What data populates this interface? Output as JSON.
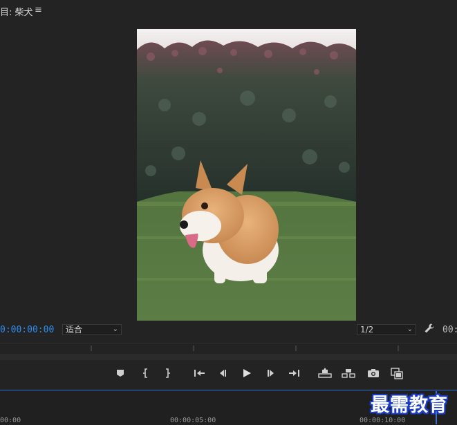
{
  "panel": {
    "title": "目: 柴犬",
    "menu_icon": "hamburger-menu-icon"
  },
  "playback": {
    "timecode_current": "0:00:00:00",
    "timecode_duration": "00:",
    "zoom": "适合",
    "resolution": "1/2"
  },
  "timeline": {
    "markers": [
      "00:00",
      "00:00:05:00",
      "00:00:10:00"
    ]
  },
  "transport": {
    "buttons": [
      {
        "name": "add-marker-button",
        "icon": "marker-icon"
      },
      {
        "name": "mark-in-button",
        "icon": "mark-in-icon"
      },
      {
        "name": "mark-out-button",
        "icon": "mark-out-icon"
      },
      {
        "name": "go-to-in-button",
        "icon": "go-to-in-icon"
      },
      {
        "name": "step-back-button",
        "icon": "step-back-icon"
      },
      {
        "name": "play-button",
        "icon": "play-icon"
      },
      {
        "name": "step-forward-button",
        "icon": "step-forward-icon"
      },
      {
        "name": "go-to-out-button",
        "icon": "go-to-out-icon"
      },
      {
        "name": "lift-button",
        "icon": "lift-icon"
      },
      {
        "name": "extract-button",
        "icon": "extract-icon"
      },
      {
        "name": "export-frame-button",
        "icon": "camera-icon"
      },
      {
        "name": "compare-view-button",
        "icon": "compare-view-icon"
      }
    ]
  },
  "watermark": {
    "text": "最需教育"
  },
  "colors": {
    "background": "#232323",
    "timecode_accent": "#2f8df0",
    "playhead": "#3d6fd1"
  }
}
